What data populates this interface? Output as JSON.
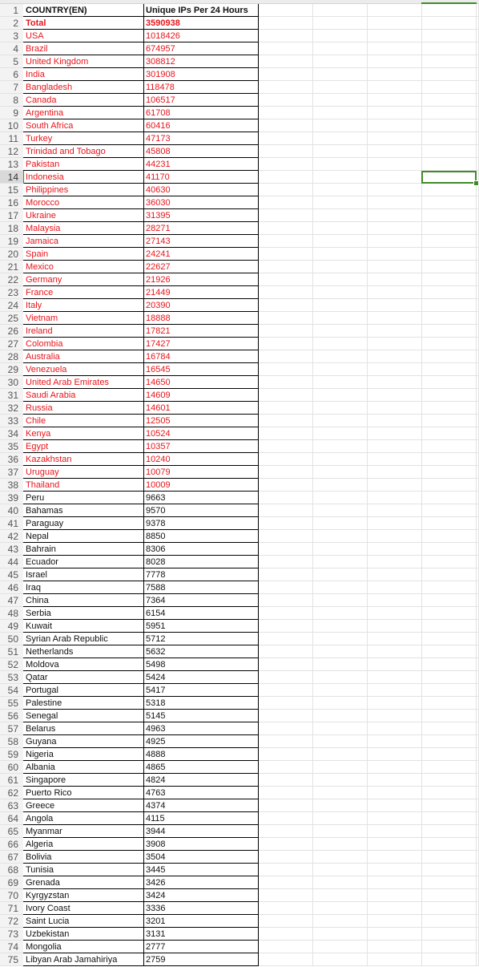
{
  "sheet": {
    "headers": [
      "COUNTRY(EN)",
      "Unique IPs Per 24 Hours"
    ],
    "selected_cell": {
      "row": 14,
      "column_index": 6
    },
    "colors": {
      "highlight_text": "#e8141b",
      "normal_text": "#111111",
      "selection": "#3f8b2a"
    },
    "rows": [
      {
        "n": "2",
        "country": "Total",
        "ips": "3590938",
        "style": "total"
      },
      {
        "n": "3",
        "country": "USA",
        "ips": "1018426",
        "style": "red"
      },
      {
        "n": "4",
        "country": "Brazil",
        "ips": "674957",
        "style": "red"
      },
      {
        "n": "5",
        "country": "United Kingdom",
        "ips": "308812",
        "style": "red"
      },
      {
        "n": "6",
        "country": "India",
        "ips": "301908",
        "style": "red"
      },
      {
        "n": "7",
        "country": "Bangladesh",
        "ips": "118478",
        "style": "red"
      },
      {
        "n": "8",
        "country": "Canada",
        "ips": "106517",
        "style": "red"
      },
      {
        "n": "9",
        "country": "Argentina",
        "ips": "61708",
        "style": "red"
      },
      {
        "n": "10",
        "country": "South Africa",
        "ips": "60416",
        "style": "red"
      },
      {
        "n": "11",
        "country": "Turkey",
        "ips": "47173",
        "style": "red"
      },
      {
        "n": "12",
        "country": "Trinidad and Tobago",
        "ips": "45808",
        "style": "red"
      },
      {
        "n": "13",
        "country": "Pakistan",
        "ips": "44231",
        "style": "red"
      },
      {
        "n": "14",
        "country": "Indonesia",
        "ips": "41170",
        "style": "red"
      },
      {
        "n": "15",
        "country": "Philippines",
        "ips": "40630",
        "style": "red"
      },
      {
        "n": "16",
        "country": "Morocco",
        "ips": "36030",
        "style": "red"
      },
      {
        "n": "17",
        "country": "Ukraine",
        "ips": "31395",
        "style": "red"
      },
      {
        "n": "18",
        "country": "Malaysia",
        "ips": "28271",
        "style": "red"
      },
      {
        "n": "19",
        "country": "Jamaica",
        "ips": "27143",
        "style": "red"
      },
      {
        "n": "20",
        "country": "Spain",
        "ips": "24241",
        "style": "red"
      },
      {
        "n": "21",
        "country": "Mexico",
        "ips": "22627",
        "style": "red"
      },
      {
        "n": "22",
        "country": "Germany",
        "ips": "21926",
        "style": "red"
      },
      {
        "n": "23",
        "country": "France",
        "ips": "21449",
        "style": "red"
      },
      {
        "n": "24",
        "country": "Italy",
        "ips": "20390",
        "style": "red"
      },
      {
        "n": "25",
        "country": "Vietnam",
        "ips": "18888",
        "style": "red"
      },
      {
        "n": "26",
        "country": "Ireland",
        "ips": "17821",
        "style": "red"
      },
      {
        "n": "27",
        "country": "Colombia",
        "ips": "17427",
        "style": "red"
      },
      {
        "n": "28",
        "country": "Australia",
        "ips": "16784",
        "style": "red"
      },
      {
        "n": "29",
        "country": "Venezuela",
        "ips": "16545",
        "style": "red"
      },
      {
        "n": "30",
        "country": "United Arab Emirates",
        "ips": "14650",
        "style": "red"
      },
      {
        "n": "31",
        "country": "Saudi Arabia",
        "ips": "14609",
        "style": "red"
      },
      {
        "n": "32",
        "country": "Russia",
        "ips": "14601",
        "style": "red"
      },
      {
        "n": "33",
        "country": "Chile",
        "ips": "12505",
        "style": "red"
      },
      {
        "n": "34",
        "country": "Kenya",
        "ips": "10524",
        "style": "red"
      },
      {
        "n": "35",
        "country": "Egypt",
        "ips": "10357",
        "style": "red"
      },
      {
        "n": "36",
        "country": "Kazakhstan",
        "ips": "10240",
        "style": "red"
      },
      {
        "n": "37",
        "country": "Uruguay",
        "ips": "10079",
        "style": "red"
      },
      {
        "n": "38",
        "country": "Thailand",
        "ips": "10009",
        "style": "red"
      },
      {
        "n": "39",
        "country": "Peru",
        "ips": "9663",
        "style": "normal"
      },
      {
        "n": "40",
        "country": "Bahamas",
        "ips": "9570",
        "style": "normal"
      },
      {
        "n": "41",
        "country": "Paraguay",
        "ips": "9378",
        "style": "normal"
      },
      {
        "n": "42",
        "country": "Nepal",
        "ips": "8850",
        "style": "normal"
      },
      {
        "n": "43",
        "country": "Bahrain",
        "ips": "8306",
        "style": "normal"
      },
      {
        "n": "44",
        "country": "Ecuador",
        "ips": "8028",
        "style": "normal"
      },
      {
        "n": "45",
        "country": "Israel",
        "ips": "7778",
        "style": "normal"
      },
      {
        "n": "46",
        "country": "Iraq",
        "ips": "7588",
        "style": "normal"
      },
      {
        "n": "47",
        "country": "China",
        "ips": "7364",
        "style": "normal"
      },
      {
        "n": "48",
        "country": "Serbia",
        "ips": "6154",
        "style": "normal"
      },
      {
        "n": "49",
        "country": "Kuwait",
        "ips": "5951",
        "style": "normal"
      },
      {
        "n": "50",
        "country": "Syrian Arab Republic",
        "ips": "5712",
        "style": "normal"
      },
      {
        "n": "51",
        "country": "Netherlands",
        "ips": "5632",
        "style": "normal"
      },
      {
        "n": "52",
        "country": "Moldova",
        "ips": "5498",
        "style": "normal"
      },
      {
        "n": "53",
        "country": "Qatar",
        "ips": "5424",
        "style": "normal"
      },
      {
        "n": "54",
        "country": "Portugal",
        "ips": "5417",
        "style": "normal"
      },
      {
        "n": "55",
        "country": "Palestine",
        "ips": "5318",
        "style": "normal"
      },
      {
        "n": "56",
        "country": "Senegal",
        "ips": "5145",
        "style": "normal"
      },
      {
        "n": "57",
        "country": "Belarus",
        "ips": "4963",
        "style": "normal"
      },
      {
        "n": "58",
        "country": "Guyana",
        "ips": "4925",
        "style": "normal"
      },
      {
        "n": "59",
        "country": "Nigeria",
        "ips": "4888",
        "style": "normal"
      },
      {
        "n": "60",
        "country": "Albania",
        "ips": "4865",
        "style": "normal"
      },
      {
        "n": "61",
        "country": "Singapore",
        "ips": "4824",
        "style": "normal"
      },
      {
        "n": "62",
        "country": "Puerto Rico",
        "ips": "4763",
        "style": "normal"
      },
      {
        "n": "63",
        "country": "Greece",
        "ips": "4374",
        "style": "normal"
      },
      {
        "n": "64",
        "country": "Angola",
        "ips": "4115",
        "style": "normal"
      },
      {
        "n": "65",
        "country": "Myanmar",
        "ips": "3944",
        "style": "normal"
      },
      {
        "n": "66",
        "country": "Algeria",
        "ips": "3908",
        "style": "normal"
      },
      {
        "n": "67",
        "country": "Bolivia",
        "ips": "3504",
        "style": "normal"
      },
      {
        "n": "68",
        "country": "Tunisia",
        "ips": "3445",
        "style": "normal"
      },
      {
        "n": "69",
        "country": "Grenada",
        "ips": "3426",
        "style": "normal"
      },
      {
        "n": "70",
        "country": "Kyrgyzstan",
        "ips": "3424",
        "style": "normal"
      },
      {
        "n": "71",
        "country": "Ivory Coast",
        "ips": "3336",
        "style": "normal"
      },
      {
        "n": "72",
        "country": "Saint Lucia",
        "ips": "3201",
        "style": "normal"
      },
      {
        "n": "73",
        "country": "Uzbekistan",
        "ips": "3131",
        "style": "normal"
      },
      {
        "n": "74",
        "country": "Mongolia",
        "ips": "2777",
        "style": "normal"
      },
      {
        "n": "75",
        "country": "Libyan Arab Jamahiriya",
        "ips": "2759",
        "style": "normal"
      }
    ],
    "header_row_number": "1"
  }
}
